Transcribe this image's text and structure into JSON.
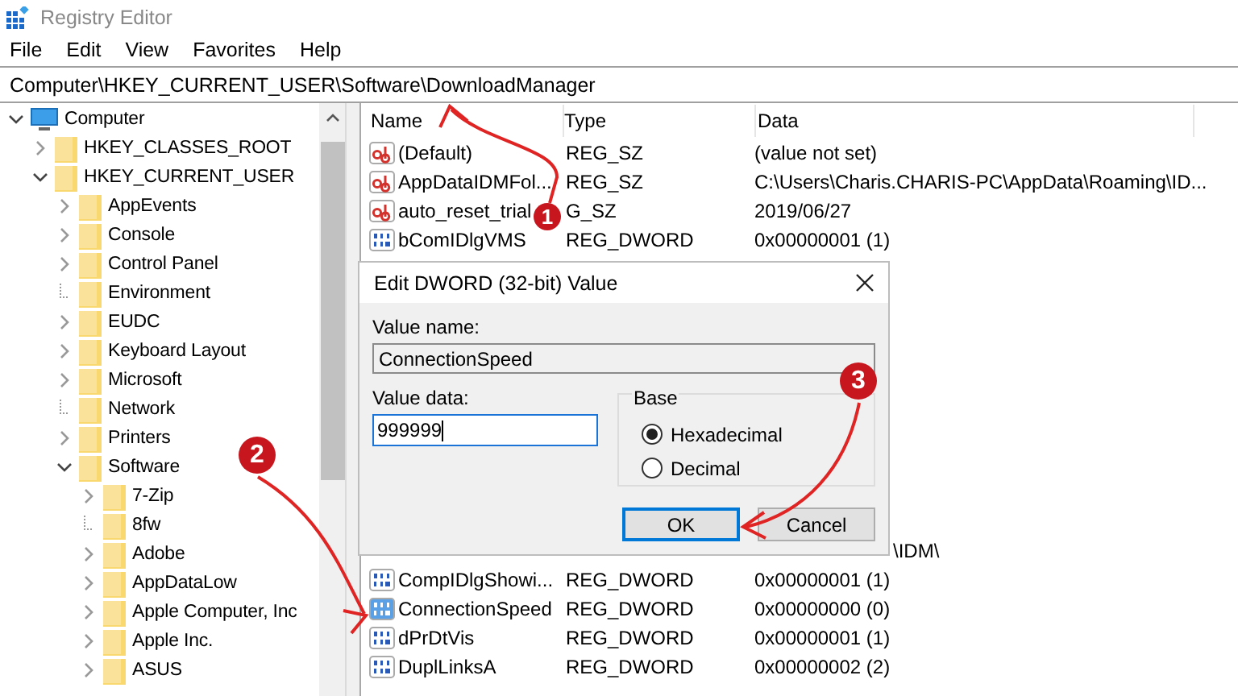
{
  "window": {
    "title": "Registry Editor"
  },
  "menu": [
    "File",
    "Edit",
    "View",
    "Favorites",
    "Help"
  ],
  "address": "Computer\\HKEY_CURRENT_USER\\Software\\DownloadManager",
  "tree": [
    {
      "label": "Computer",
      "kind": "computer",
      "expanded": true,
      "children": [
        {
          "label": "HKEY_CLASSES_ROOT",
          "kind": "key",
          "expanded": false
        },
        {
          "label": "HKEY_CURRENT_USER",
          "kind": "key",
          "expanded": true,
          "children": [
            {
              "label": "AppEvents",
              "kind": "key",
              "expanded": false
            },
            {
              "label": "Console",
              "kind": "key",
              "expanded": false
            },
            {
              "label": "Control Panel",
              "kind": "key",
              "expanded": false
            },
            {
              "label": "Environment",
              "kind": "leaf"
            },
            {
              "label": "EUDC",
              "kind": "key",
              "expanded": false
            },
            {
              "label": "Keyboard Layout",
              "kind": "key",
              "expanded": false
            },
            {
              "label": "Microsoft",
              "kind": "key",
              "expanded": false
            },
            {
              "label": "Network",
              "kind": "leaf"
            },
            {
              "label": "Printers",
              "kind": "key",
              "expanded": false
            },
            {
              "label": "Software",
              "kind": "key",
              "expanded": true,
              "children": [
                {
                  "label": "7-Zip",
                  "kind": "key",
                  "expanded": false
                },
                {
                  "label": "8fw",
                  "kind": "leaf"
                },
                {
                  "label": "Adobe",
                  "kind": "key",
                  "expanded": false
                },
                {
                  "label": "AppDataLow",
                  "kind": "key",
                  "expanded": false
                },
                {
                  "label": "Apple Computer, Inc",
                  "kind": "key",
                  "expanded": false
                },
                {
                  "label": "Apple Inc.",
                  "kind": "key",
                  "expanded": false
                },
                {
                  "label": "ASUS",
                  "kind": "key",
                  "expanded": false
                }
              ]
            }
          ]
        }
      ]
    }
  ],
  "list": {
    "columns": [
      "Name",
      "Type",
      "Data"
    ],
    "rows_top": [
      {
        "kind": "string",
        "name": "(Default)",
        "type": "REG_SZ",
        "data": "(value not set)",
        "selected": false
      },
      {
        "kind": "string",
        "name": "AppDataIDMFol...",
        "type": "REG_SZ",
        "data": "C:\\Users\\Charis.CHARIS-PC\\AppData\\Roaming\\ID...",
        "selected": false
      },
      {
        "kind": "string",
        "name": "auto_reset_trial",
        "type": "G_SZ",
        "data": "2019/06/27",
        "selected": false
      },
      {
        "kind": "dword",
        "name": "bComIDlgVMS",
        "type": "REG_DWORD",
        "data": "0x00000001 (1)",
        "selected": false
      }
    ],
    "rows_bottom": [
      {
        "kind": "partial",
        "data": "\\IDM\\"
      },
      {
        "kind": "dword",
        "name": "CompIDlgShowi...",
        "type": "REG_DWORD",
        "data": "0x00000001 (1)",
        "selected": false
      },
      {
        "kind": "dword",
        "name": "ConnectionSpeed",
        "type": "REG_DWORD",
        "data": "0x00000000 (0)",
        "selected": true
      },
      {
        "kind": "dword",
        "name": "dPrDtVis",
        "type": "REG_DWORD",
        "data": "0x00000001 (1)",
        "selected": false
      },
      {
        "kind": "dword",
        "name": "DuplLinksA",
        "type": "REG_DWORD",
        "data": "0x00000002 (2)",
        "selected": false
      }
    ]
  },
  "dialog": {
    "title": "Edit DWORD (32-bit) Value",
    "value_name_label": "Value name:",
    "value_name": "ConnectionSpeed",
    "value_data_label": "Value data:",
    "value_data": "999999",
    "base_label": "Base",
    "base_options": [
      {
        "label": "Hexadecimal",
        "selected": true
      },
      {
        "label": "Decimal",
        "selected": false
      }
    ],
    "buttons": [
      {
        "label": "OK",
        "default": true
      },
      {
        "label": "Cancel",
        "default": false
      }
    ]
  },
  "annotations": [
    {
      "number": "1"
    },
    {
      "number": "2"
    },
    {
      "number": "3"
    }
  ]
}
